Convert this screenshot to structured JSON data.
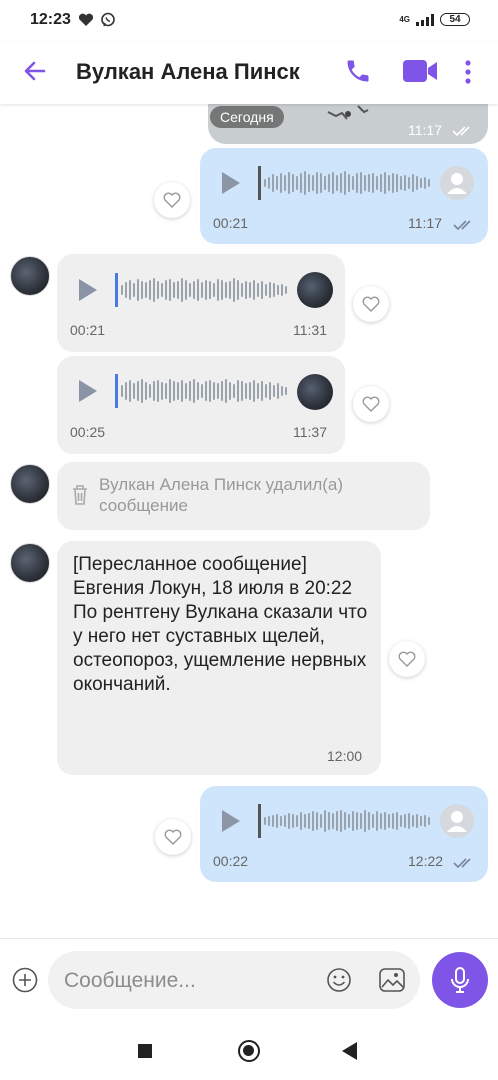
{
  "status": {
    "time": "12:23",
    "network": "4G",
    "battery": "54"
  },
  "header": {
    "title": "Вулкан Алена Пинск"
  },
  "chat": {
    "date_chip": "Сегодня",
    "photo_time": "11:17",
    "messages": [
      {
        "duration": "00:21",
        "time": "11:17"
      },
      {
        "duration": "00:21",
        "time": "11:31"
      },
      {
        "duration": "00:25",
        "time": "11:37"
      },
      {
        "deleted_text": "Вулкан Алена Пинск удалил(а) сообщение"
      },
      {
        "text": "[Пересланное сообщение]\nЕвгения Локун, 18 июля в 20:22\nПо рентгену Вулкана сказали что у него нет суставных щелей, остеопороз, ущемление нервных окончаний.",
        "time": "12:00"
      },
      {
        "duration": "00:22",
        "time": "12:22"
      }
    ]
  },
  "composer": {
    "placeholder": "Сообщение..."
  },
  "colors": {
    "accent": "#7f55e8",
    "outgoing": "#cfe5fb",
    "incoming": "#efefef",
    "progress": "#4a7be0"
  }
}
